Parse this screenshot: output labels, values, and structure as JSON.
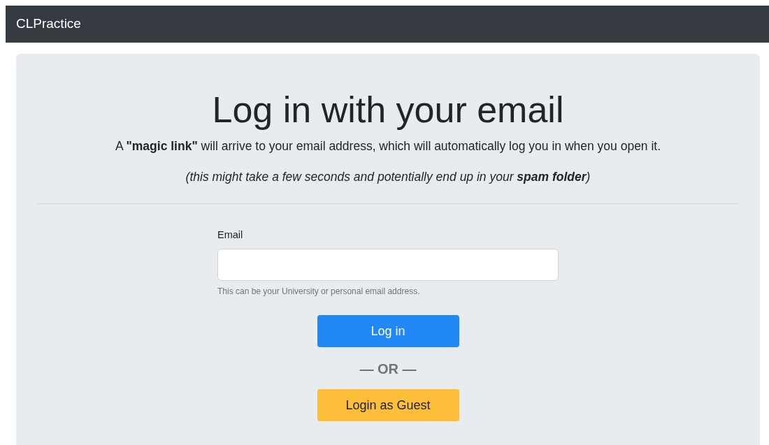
{
  "navbar": {
    "brand": "CLPractice"
  },
  "heading": "Log in with your email",
  "lead": "A **\"magic link\"** will arrive to your email address, which will automatically log you in when you open it.",
  "note": "(this might take a few seconds and potentially end up in your **spam folder**)",
  "form": {
    "label": "Email",
    "help": "This can be your University or personal email address.",
    "submit": "Log in",
    "separator": "— OR —",
    "guest": "Login as Guest"
  }
}
